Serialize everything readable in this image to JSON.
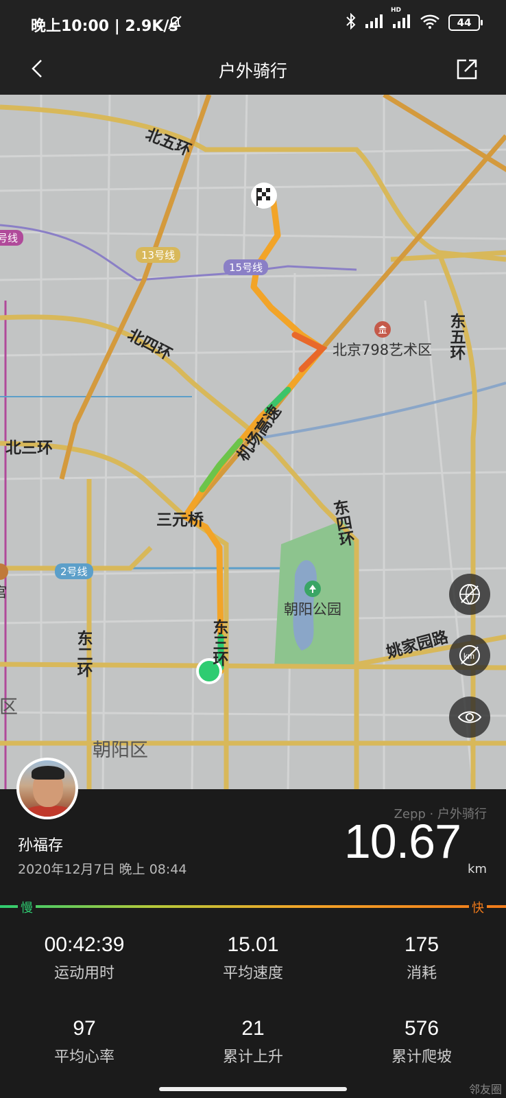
{
  "status_bar": {
    "time": "晚上10:00 | 2.9K/s",
    "battery": "44",
    "network": "HD"
  },
  "nav": {
    "title": "户外骑行"
  },
  "map": {
    "road_labels": [
      "北五环",
      "北四环",
      "北三环",
      "东五环",
      "东四环",
      "三元桥",
      "机场高速",
      "东二环",
      "姚家园路"
    ],
    "east_third_ring": "东三环",
    "district_labels": [
      "朝阳区",
      "城区"
    ],
    "metro_lines": [
      {
        "name": "13号线",
        "color": "#d8b85a"
      },
      {
        "name": "15号线",
        "color": "#8a7fc6"
      },
      {
        "name": "2号线",
        "color": "#5c9fc9"
      },
      {
        "name": "号线",
        "color": "#b04a9a"
      }
    ],
    "pois": [
      {
        "name": "北京798艺术区",
        "icon": "museum-icon",
        "color": "#c45a4a"
      },
      {
        "name": "朝阳公园",
        "icon": "park-tree-icon",
        "color": "#3aa565"
      },
      {
        "name": "宫",
        "icon": "landmark-icon",
        "color": "#c07a3a"
      }
    ],
    "controls": [
      "no-satellite-icon",
      "no-km-marker-icon",
      "eye-icon"
    ]
  },
  "activity": {
    "user": "孙福存",
    "datetime": "2020年12月7日 晚上 08:44",
    "source": "Zepp · 户外骑行",
    "distance": "10.67",
    "distance_unit": "km",
    "speed_legend": {
      "slow": "慢",
      "fast": "快"
    },
    "stats": [
      {
        "value": "00:42:39",
        "label": "运动用时"
      },
      {
        "value": "15.01",
        "label": "平均速度"
      },
      {
        "value": "175",
        "label": "消耗"
      },
      {
        "value": "97",
        "label": "平均心率"
      },
      {
        "value": "21",
        "label": "累计上升"
      },
      {
        "value": "576",
        "label": "累计爬坡"
      }
    ]
  },
  "watermark": "邻友圈"
}
